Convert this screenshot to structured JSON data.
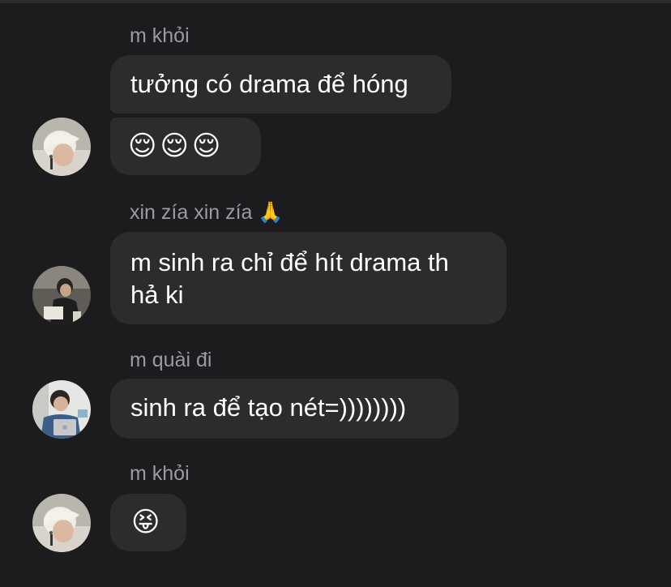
{
  "messages": [
    {
      "sender": "m khỏi",
      "bubbles": [
        {
          "text": "tưởng có drama để hóng"
        },
        {
          "text": "😌😌😌"
        }
      ]
    },
    {
      "sender": "xin zía xin zía 🙏",
      "bubbles": [
        {
          "line1": "m sinh ra chỉ để hít drama th",
          "line2": "hả ki"
        }
      ]
    },
    {
      "sender": "m quài đi",
      "bubbles": [
        {
          "text": "sinh ra để tạo nét=))))))))"
        }
      ]
    },
    {
      "sender": "m khỏi",
      "bubbles": [
        {
          "text": "😝"
        }
      ]
    }
  ],
  "colors": {
    "background": "#1c1c1e",
    "bubble": "#2c2c2e",
    "sender_text": "#9a9aa0",
    "message_text": "#ffffff"
  }
}
